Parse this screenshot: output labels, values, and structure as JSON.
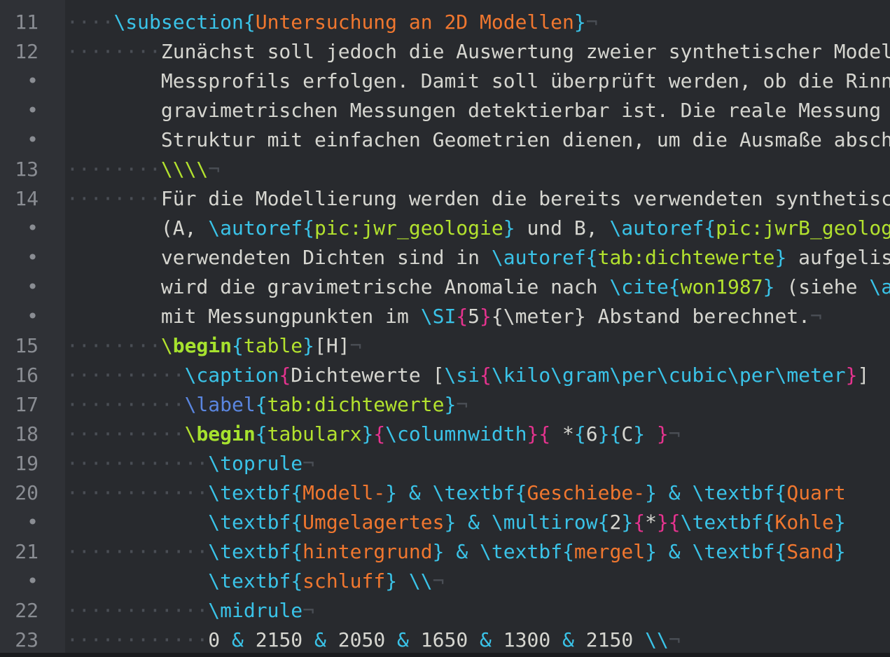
{
  "editor": {
    "lines": [
      {
        "n": "11",
        "segs": [
          [
            "ws",
            "····"
          ],
          [
            "cmd",
            "\\subsection"
          ],
          [
            "br",
            "{"
          ],
          [
            "arg-or",
            "Untersuchung an 2D Modellen"
          ],
          [
            "br",
            "}"
          ],
          [
            "pil",
            "¬"
          ]
        ]
      },
      {
        "n": "12",
        "segs": [
          [
            "ws",
            "········"
          ],
          [
            "arg-txt",
            "Zunächst soll jedoch die Auswertung zweier synthetischer Model"
          ]
        ]
      },
      {
        "n": "•",
        "segs": [
          [
            "ws",
            "        "
          ],
          [
            "arg-txt",
            "Messprofils erfolgen. Damit soll überprüft werden, ob die Rinn"
          ]
        ]
      },
      {
        "n": "•",
        "segs": [
          [
            "ws",
            "        "
          ],
          [
            "arg-txt",
            "gravimetrischen Messungen detektierbar ist. Die reale Messung "
          ]
        ]
      },
      {
        "n": "•",
        "segs": [
          [
            "ws",
            "        "
          ],
          [
            "arg-txt",
            "Struktur mit einfachen Geometrien dienen, um die Ausmaße absch"
          ]
        ]
      },
      {
        "n": "13",
        "segs": [
          [
            "ws",
            "········"
          ],
          [
            "lit-gr",
            "\\\\\\\\"
          ],
          [
            "pil",
            "¬"
          ]
        ]
      },
      {
        "n": "14",
        "segs": [
          [
            "ws",
            "········"
          ],
          [
            "arg-txt",
            "Für die Modellierung werden die bereits verwendeten synthetisc"
          ]
        ]
      },
      {
        "n": "•",
        "segs": [
          [
            "ws",
            "        "
          ],
          [
            "arg-txt",
            "(A, "
          ],
          [
            "cmd",
            "\\autoref"
          ],
          [
            "br",
            "{"
          ],
          [
            "arg-gr",
            "pic:jwr_geologie"
          ],
          [
            "br",
            "}"
          ],
          [
            "arg-txt",
            " und B, "
          ],
          [
            "cmd",
            "\\autoref"
          ],
          [
            "br",
            "{"
          ],
          [
            "arg-gr",
            "pic:jwrB_geolog"
          ]
        ]
      },
      {
        "n": "•",
        "segs": [
          [
            "ws",
            "        "
          ],
          [
            "arg-txt",
            "verwendeten Dichten sind in "
          ],
          [
            "cmd",
            "\\autoref"
          ],
          [
            "br",
            "{"
          ],
          [
            "arg-gr",
            "tab:dichtewerte"
          ],
          [
            "br",
            "}"
          ],
          [
            "arg-txt",
            " aufgelis"
          ]
        ]
      },
      {
        "n": "•",
        "segs": [
          [
            "ws",
            "        "
          ],
          [
            "arg-txt",
            "wird die gravimetrische Anomalie nach "
          ],
          [
            "cmd",
            "\\cite"
          ],
          [
            "br",
            "{"
          ],
          [
            "arg-gr",
            "won1987"
          ],
          [
            "br",
            "}"
          ],
          [
            "arg-txt",
            " (siehe "
          ],
          [
            "cmd",
            "\\a"
          ]
        ]
      },
      {
        "n": "•",
        "segs": [
          [
            "ws",
            "        "
          ],
          [
            "arg-txt",
            "mit Messungpunkten im "
          ],
          [
            "cmd",
            "\\SI"
          ],
          [
            "brm",
            "{"
          ],
          [
            "arg-txt",
            "5"
          ],
          [
            "brm",
            "}"
          ],
          [
            "arg-txt",
            "{\\meter} Abstand berechnet."
          ],
          [
            "pil",
            "¬"
          ]
        ]
      },
      {
        "n": "15",
        "segs": [
          [
            "ws",
            "········"
          ],
          [
            "lit-gr",
            "\\"
          ],
          [
            "kw",
            "begin"
          ],
          [
            "br",
            "{"
          ],
          [
            "arg-gr",
            "table"
          ],
          [
            "br",
            "}"
          ],
          [
            "arg-txt",
            "[H]"
          ],
          [
            "pil",
            "¬"
          ]
        ]
      },
      {
        "n": "16",
        "segs": [
          [
            "ws",
            "··········"
          ],
          [
            "cmd",
            "\\caption"
          ],
          [
            "brm",
            "{"
          ],
          [
            "arg-txt",
            "Dichtewerte ["
          ],
          [
            "cmd",
            "\\si"
          ],
          [
            "brm",
            "{"
          ],
          [
            "cmd",
            "\\kilo\\gram\\per\\cubic\\per\\meter"
          ],
          [
            "brm",
            "}"
          ],
          [
            "arg-txt",
            "]"
          ]
        ]
      },
      {
        "n": "17",
        "segs": [
          [
            "ws",
            "··········"
          ],
          [
            "lbl",
            "\\label"
          ],
          [
            "br",
            "{"
          ],
          [
            "arg-gr",
            "tab:dichtewerte"
          ],
          [
            "br",
            "}"
          ],
          [
            "pil",
            "¬"
          ]
        ]
      },
      {
        "n": "18",
        "segs": [
          [
            "ws",
            "··········"
          ],
          [
            "lit-gr",
            "\\"
          ],
          [
            "kw",
            "begin"
          ],
          [
            "br",
            "{"
          ],
          [
            "arg-gr",
            "tabularx"
          ],
          [
            "br",
            "}"
          ],
          [
            "brm",
            "{"
          ],
          [
            "cmd",
            "\\columnwidth"
          ],
          [
            "brm",
            "}"
          ],
          [
            "brm",
            "{"
          ],
          [
            "arg-txt",
            " *"
          ],
          [
            "br",
            "{"
          ],
          [
            "arg-txt",
            "6"
          ],
          [
            "br",
            "}"
          ],
          [
            "br",
            "{"
          ],
          [
            "arg-txt",
            "C"
          ],
          [
            "br",
            "}"
          ],
          [
            "brm",
            " }"
          ],
          [
            "pil",
            "¬"
          ]
        ]
      },
      {
        "n": "19",
        "segs": [
          [
            "ws",
            "············"
          ],
          [
            "cmd",
            "\\toprule"
          ],
          [
            "pil",
            "¬"
          ]
        ]
      },
      {
        "n": "20",
        "segs": [
          [
            "ws",
            "············"
          ],
          [
            "cmd",
            "\\textbf"
          ],
          [
            "br",
            "{"
          ],
          [
            "arg-or",
            "Modell-"
          ],
          [
            "br",
            "}"
          ],
          [
            "amp",
            " & "
          ],
          [
            "cmd",
            "\\textbf"
          ],
          [
            "br",
            "{"
          ],
          [
            "arg-or",
            "Geschiebe-"
          ],
          [
            "br",
            "}"
          ],
          [
            "amp",
            " & "
          ],
          [
            "cmd",
            "\\textbf"
          ],
          [
            "br",
            "{"
          ],
          [
            "arg-or",
            "Quart"
          ]
        ]
      },
      {
        "n": "•",
        "segs": [
          [
            "ws",
            "            "
          ],
          [
            "cmd",
            "\\textbf"
          ],
          [
            "br",
            "{"
          ],
          [
            "arg-or",
            "Umgelagertes"
          ],
          [
            "br",
            "}"
          ],
          [
            "amp",
            " & "
          ],
          [
            "cmd",
            "\\multirow"
          ],
          [
            "br",
            "{"
          ],
          [
            "arg-txt",
            "2"
          ],
          [
            "br",
            "}"
          ],
          [
            "brm",
            "{"
          ],
          [
            "arg-txt",
            "*"
          ],
          [
            "brm",
            "}"
          ],
          [
            "brm",
            "{"
          ],
          [
            "cmd",
            "\\textbf"
          ],
          [
            "br",
            "{"
          ],
          [
            "arg-or",
            "Kohle"
          ],
          [
            "br",
            "}"
          ]
        ]
      },
      {
        "n": "21",
        "segs": [
          [
            "ws",
            "············"
          ],
          [
            "cmd",
            "\\textbf"
          ],
          [
            "br",
            "{"
          ],
          [
            "arg-or",
            "hintergrund"
          ],
          [
            "br",
            "}"
          ],
          [
            "amp",
            " & "
          ],
          [
            "cmd",
            "\\textbf"
          ],
          [
            "br",
            "{"
          ],
          [
            "arg-or",
            "mergel"
          ],
          [
            "br",
            "}"
          ],
          [
            "amp",
            " & "
          ],
          [
            "cmd",
            "\\textbf"
          ],
          [
            "br",
            "{"
          ],
          [
            "arg-or",
            "Sand"
          ],
          [
            "br",
            "}"
          ]
        ]
      },
      {
        "n": "•",
        "segs": [
          [
            "ws",
            "            "
          ],
          [
            "cmd",
            "\\textbf"
          ],
          [
            "br",
            "{"
          ],
          [
            "arg-or",
            "schluff"
          ],
          [
            "br",
            "}"
          ],
          [
            "arg-txt",
            " "
          ],
          [
            "br",
            "\\\\"
          ],
          [
            "pil",
            "¬"
          ]
        ]
      },
      {
        "n": "22",
        "segs": [
          [
            "ws",
            "············"
          ],
          [
            "cmd",
            "\\midrule"
          ],
          [
            "pil",
            "¬"
          ]
        ]
      },
      {
        "n": "23",
        "segs": [
          [
            "ws",
            "············"
          ],
          [
            "arg-txt",
            "0"
          ],
          [
            "amp",
            " & "
          ],
          [
            "arg-txt",
            "2150"
          ],
          [
            "amp",
            " & "
          ],
          [
            "arg-txt",
            "2050"
          ],
          [
            "amp",
            " & "
          ],
          [
            "arg-txt",
            "1650"
          ],
          [
            "amp",
            " & "
          ],
          [
            "arg-txt",
            "1300"
          ],
          [
            "amp",
            " & "
          ],
          [
            "arg-txt",
            "2150"
          ],
          [
            "arg-txt",
            " "
          ],
          [
            "br",
            "\\\\"
          ],
          [
            "pil",
            "¬"
          ]
        ]
      }
    ]
  },
  "colors": {
    "background": "#282a2e",
    "gutter": "#2f3136",
    "command": "#3ac3e8",
    "keyword": "#a6e22e",
    "argument_orange": "#f0772f",
    "argument_green": "#b3e22e",
    "brace_magenta": "#e6338f",
    "text": "#d6d6d0",
    "line_number": "#8a8d93",
    "invisible": "#4a4e55"
  }
}
